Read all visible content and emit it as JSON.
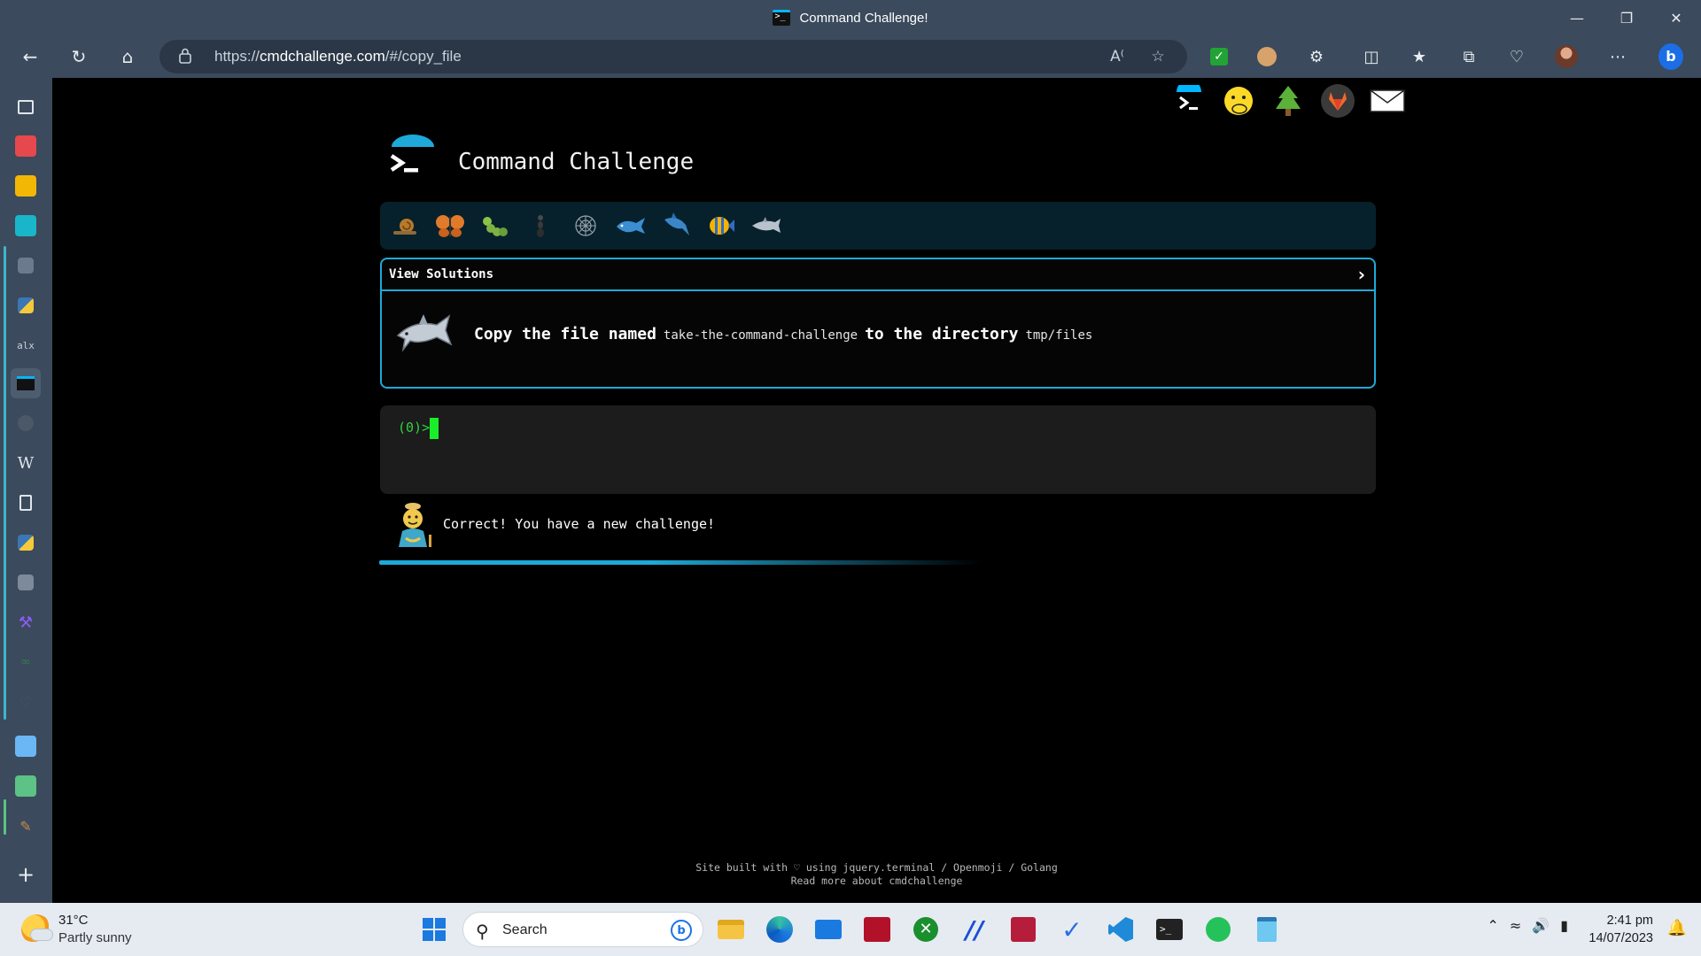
{
  "window": {
    "title": "Command Challenge!",
    "controls": [
      "minimize",
      "restore",
      "close"
    ]
  },
  "browser": {
    "url_prefix": "https://",
    "url_host": "cmdchallenge.com",
    "url_path": "/#/copy_file"
  },
  "page": {
    "site_title": "Command Challenge",
    "top_icons": [
      "terminal-logo-icon",
      "face-with-hand-over-mouth-icon",
      "evergreen-tree-icon",
      "gitlab-icon",
      "envelope-icon"
    ],
    "emoji_bar": [
      "snail-icon",
      "butterfly-icon",
      "caterpillar-icon",
      "ant-icon",
      "spider-web-icon",
      "whale-icon",
      "shark-icon",
      "tropical-fish-icon",
      "dolphin-icon"
    ],
    "challenge": {
      "header_label": "View Solutions",
      "text_before": "Copy the file named",
      "filename": "take-the-command-challenge",
      "text_middle": "to the directory",
      "directory": "tmp/files"
    },
    "terminal": {
      "prompt": "(0)>"
    },
    "result": {
      "message": "Correct! You have a new challenge!"
    },
    "footer": {
      "line1": "Site built with ♡ using jquery.terminal / Openmoji / Golang",
      "line2": "Read more about cmdchallenge"
    }
  },
  "taskbar": {
    "weather_temp": "31°C",
    "weather_condition": "Partly sunny",
    "search_placeholder": "Search",
    "time": "2:41 pm",
    "date": "14/07/2023"
  },
  "colors": {
    "accent": "#1ea9d8",
    "prompt_green": "#2fd33f",
    "chrome_bg": "#3b4a5c"
  }
}
